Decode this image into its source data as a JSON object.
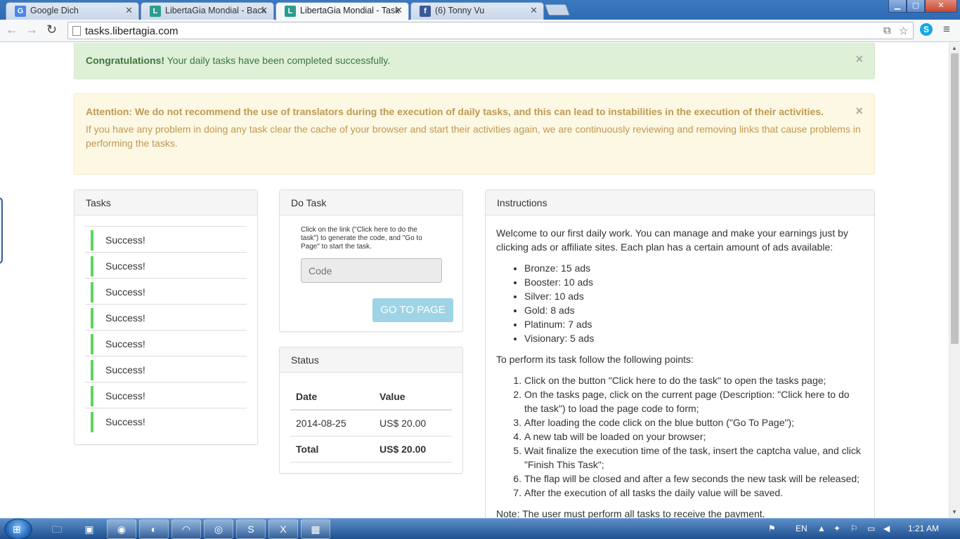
{
  "browser": {
    "tabs": [
      {
        "title": "Google Dich",
        "icon": "google-translate-icon"
      },
      {
        "title": "LibertaGia Mondial - Back",
        "icon": "libertagia-icon"
      },
      {
        "title": "LibertaGia Mondial - Task",
        "icon": "libertagia-icon",
        "active": true
      },
      {
        "title": "(6) Tonny Vu",
        "icon": "facebook-icon"
      }
    ],
    "url": "tasks.libertagia.com"
  },
  "alerts": {
    "success_strong": "Congratulations!",
    "success_text": " Your daily tasks have been completed successfully.",
    "warning_strong": "Attention: We do not recommend the use of translators during the execution of daily tasks, and this can lead to instabilities in the execution of their activities.",
    "warning_text": "If you have any problem in doing any task clear the cache of your browser and start their activities again, we are continuously reviewing and removing links that cause problems in performing the tasks.",
    "close_symbol": "×"
  },
  "tasks": {
    "heading": "Tasks",
    "items": [
      "Success!",
      "Success!",
      "Success!",
      "Success!",
      "Success!",
      "Success!",
      "Success!",
      "Success!"
    ],
    "bar_color": "#5cd65c"
  },
  "do_task": {
    "heading": "Do Task",
    "instructions": "Click on the link (\"Click here to do the task\") to generate the code, and \"Go to Page\" to start the task.",
    "code_placeholder": "Code",
    "button_label": "GO TO PAGE"
  },
  "status": {
    "heading": "Status",
    "col_date": "Date",
    "col_value": "Value",
    "rows": [
      {
        "date": "2014-08-25",
        "value": "US$ 20.00"
      }
    ],
    "total_label": "Total",
    "total_value": "US$ 20.00"
  },
  "instructions": {
    "heading": "Instructions",
    "intro": "Welcome to our first daily work. You can manage and make your earnings just by clicking ads or affiliate sites. Each plan has a certain amount of ads available:",
    "plans": [
      "Bronze: 15 ads",
      "Booster: 10 ads",
      "Silver: 10 ads",
      "Gold: 8 ads",
      "Platinum: 7 ads",
      "Visionary: 5 ads"
    ],
    "steps_intro": "To perform its task follow the following points:",
    "steps": [
      "Click on the button \"Click here to do the task\" to open the tasks page;",
      "On the tasks page, click on the current page (Description: \"Click here to do the task\") to load the page code to form;",
      "After loading the code click on the blue button (\"Go To Page\");",
      "A new tab will be loaded on your browser;",
      "Wait finalize the execution time of the task, insert the captcha value, and click \"Finish This Task\";",
      "The flap will be closed and after a few seconds the new task will be released;",
      "After the execution of all tasks the daily value will be saved."
    ],
    "note": "Note: The user must perform all tasks to receive the payment."
  },
  "taskbar": {
    "language": "EN",
    "time": "1:21 AM"
  }
}
